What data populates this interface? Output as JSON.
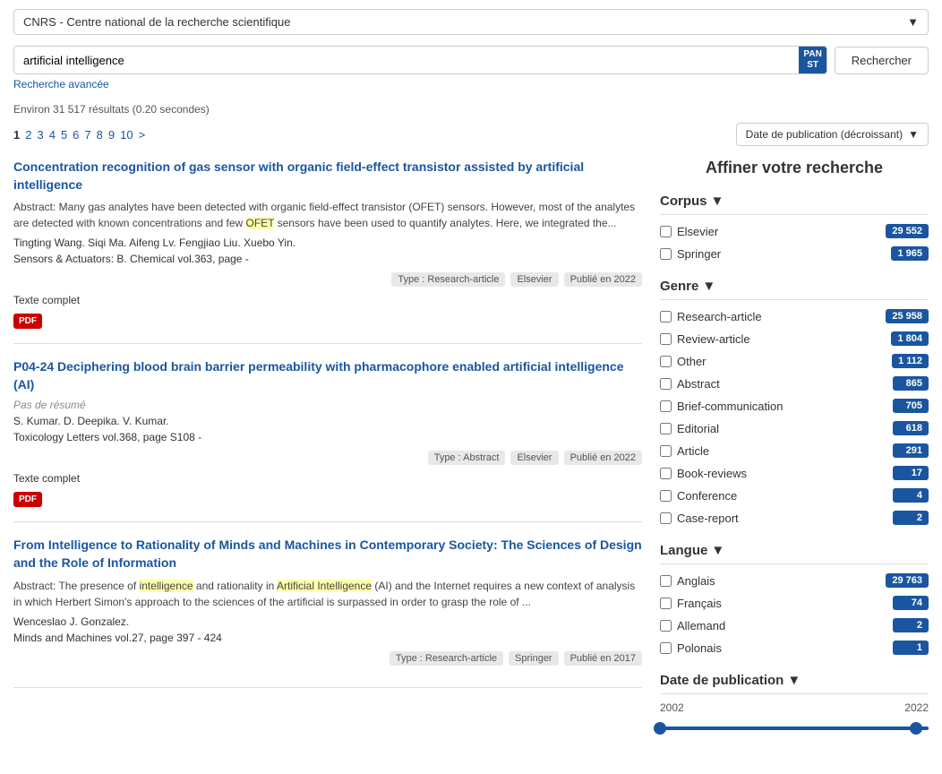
{
  "institution": {
    "label": "CNRS - Centre national de la recherche scientifique"
  },
  "search": {
    "query": "artificial intelligence",
    "placeholder": "artificial intelligence",
    "pan_line1": "PAN",
    "pan_line2": "ST",
    "button_label": "Rechercher",
    "advanced_label": "Recherche avancée"
  },
  "results": {
    "summary": "Environ 31 517 résultats (0.20 secondes)",
    "pages": [
      "1",
      "2",
      "3",
      "4",
      "5",
      "6",
      "7",
      "8",
      "9",
      "10",
      ">"
    ],
    "sort_label": "Date de publication (décroissant)"
  },
  "articles": [
    {
      "title": "Concentration recognition of gas sensor with organic field-effect transistor assisted by artificial intelligence",
      "abstract": "Abstract: Many gas analytes have been detected with organic field-effect transistor (OFET) sensors. However, most of the analytes are detected with known concentrations and few OFET sensors have been used to quantify analytes. Here, we integrated the...",
      "authors": "Tingting Wang. Siqi Ma. Aifeng Lv. Fengjiao Liu. Xuebo Yin.",
      "journal": "Sensors & Actuators: B. Chemical vol.363, page -",
      "tags": [
        "Type : Research-article",
        "Elsevier",
        "Publié en 2022"
      ],
      "fulltext": "Texte complet",
      "pdf": "PDF",
      "no_abstract": null
    },
    {
      "title": "P04-24 Deciphering blood brain barrier permeability with pharmacophore enabled artificial intelligence (AI)",
      "abstract": null,
      "no_abstract": "Pas de résumé",
      "authors": "S. Kumar. D. Deepika. V. Kumar.",
      "journal": "Toxicology Letters vol.368, page S108 -",
      "tags": [
        "Type : Abstract",
        "Elsevier",
        "Publié en 2022"
      ],
      "fulltext": "Texte complet",
      "pdf": "PDF"
    },
    {
      "title": "From Intelligence to Rationality of Minds and Machines in Contemporary Society: The Sciences of Design and the Role of Information",
      "abstract": "Abstract: The presence of intelligence and rationality in Artificial Intelligence (AI) and the Internet requires a new context of analysis in which Herbert Simon's approach to the sciences of the artificial is surpassed in order to grasp the role of ...",
      "no_abstract": null,
      "authors": "Wenceslao J. Gonzalez.",
      "journal": "Minds and Machines vol.27, page 397 - 424",
      "tags": [
        "Type : Research-article",
        "Springer",
        "Publié en 2017"
      ],
      "fulltext": null,
      "pdf": null
    }
  ],
  "sidebar": {
    "title": "Affiner votre recherche",
    "corpus": {
      "header": "Corpus",
      "items": [
        {
          "label": "Elsevier",
          "count": "29 552"
        },
        {
          "label": "Springer",
          "count": "1 965"
        }
      ]
    },
    "genre": {
      "header": "Genre",
      "items": [
        {
          "label": "Research-article",
          "count": "25 958"
        },
        {
          "label": "Review-article",
          "count": "1 804"
        },
        {
          "label": "Other",
          "count": "1 112"
        },
        {
          "label": "Abstract",
          "count": "865"
        },
        {
          "label": "Brief-communication",
          "count": "705"
        },
        {
          "label": "Editorial",
          "count": "618"
        },
        {
          "label": "Article",
          "count": "291"
        },
        {
          "label": "Book-reviews",
          "count": "17"
        },
        {
          "label": "Conference",
          "count": "4"
        },
        {
          "label": "Case-report",
          "count": "2"
        }
      ]
    },
    "langue": {
      "header": "Langue",
      "items": [
        {
          "label": "Anglais",
          "count": "29 763"
        },
        {
          "label": "Français",
          "count": "74"
        },
        {
          "label": "Allemand",
          "count": "2"
        },
        {
          "label": "Polonais",
          "count": "1"
        }
      ]
    },
    "date": {
      "header": "Date de publication",
      "min": "2002",
      "max": "2022"
    }
  }
}
